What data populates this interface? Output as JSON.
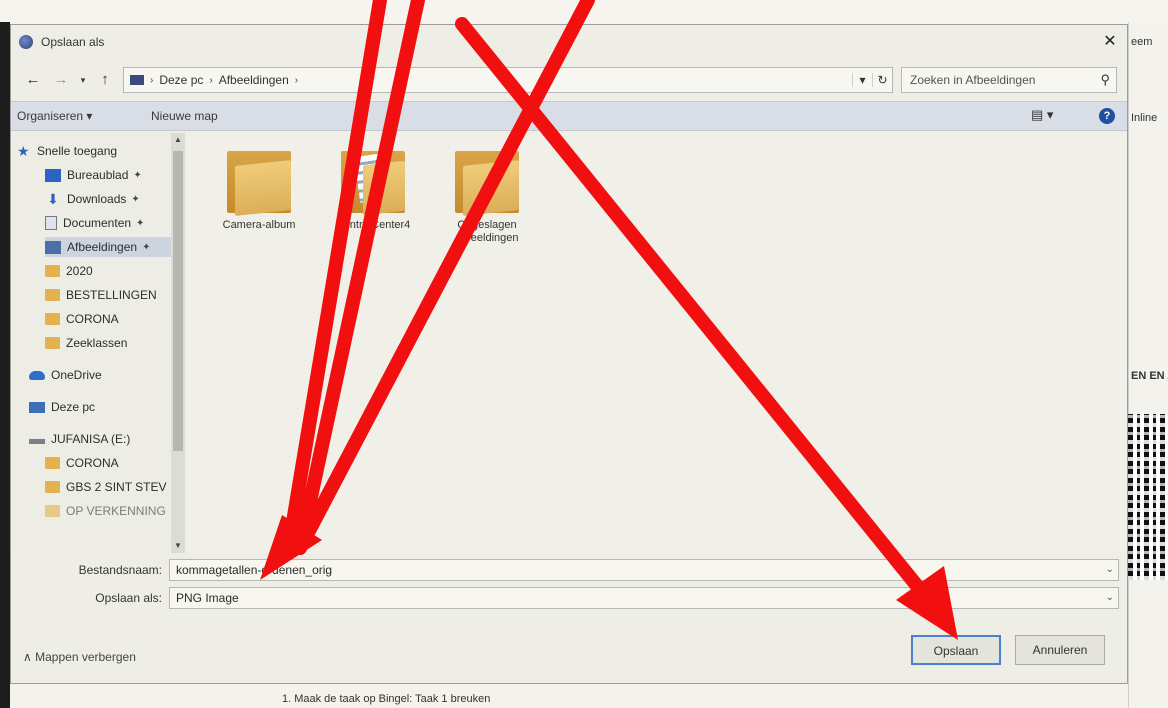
{
  "dialog": {
    "title": "Opslaan als",
    "close_glyph": "✕"
  },
  "address": {
    "crumbs": [
      "Deze pc",
      "Afbeeldingen"
    ],
    "search_placeholder": "Zoeken in Afbeeldingen"
  },
  "toolbar": {
    "organize_label": "Organiseren ▾",
    "new_folder_label": "Nieuwe map"
  },
  "nav": {
    "items": [
      {
        "label": "Snelle toegang",
        "icon": "star-icon"
      },
      {
        "label": "Bureaublad",
        "icon": "desktop-icon",
        "pinned": "✦"
      },
      {
        "label": "Downloads",
        "icon": "download-icon",
        "pinned": "✦"
      },
      {
        "label": "Documenten",
        "icon": "documents-icon",
        "pinned": "✦"
      },
      {
        "label": "Afbeeldingen",
        "icon": "pictures-icon",
        "pinned": "✦"
      },
      {
        "label": "2020",
        "icon": "folder-icon"
      },
      {
        "label": "BESTELLINGEN",
        "icon": "folder-icon"
      },
      {
        "label": "CORONA",
        "icon": "folder-icon"
      },
      {
        "label": "Zeeklassen",
        "icon": "folder-icon"
      },
      {
        "label": "OneDrive",
        "icon": "cloud-icon"
      },
      {
        "label": "Deze pc",
        "icon": "computer-icon"
      },
      {
        "label": "JUFANISA (E:)",
        "icon": "drive-icon"
      },
      {
        "label": "CORONA",
        "icon": "folder-icon"
      },
      {
        "label": "GBS 2 SINT STEV",
        "icon": "folder-icon"
      },
      {
        "label": "OP VERKENNING",
        "icon": "folder-icon"
      }
    ]
  },
  "files": [
    {
      "name": "Camera-album"
    },
    {
      "name": "ControlCenter4"
    },
    {
      "name": "Opgeslagen afbeeldingen"
    }
  ],
  "form": {
    "filename_label": "Bestandsnaam:",
    "filename_value": "kommagetallen-ordenen_orig",
    "type_label": "Opslaan als:",
    "type_value": "PNG Image"
  },
  "footer": {
    "hide_folders_label": "Mappen verbergen",
    "save_label": "Opslaan",
    "cancel_label": "Annuleren"
  },
  "background": {
    "fragments": [
      "eem",
      "Inline",
      "EN EN AF"
    ],
    "bottom_text": "1.  Maak de taak op Bingel: Taak 1 breuken"
  },
  "colors": {
    "annotation": "#f20f0f",
    "accent": "#4d7fcf"
  }
}
